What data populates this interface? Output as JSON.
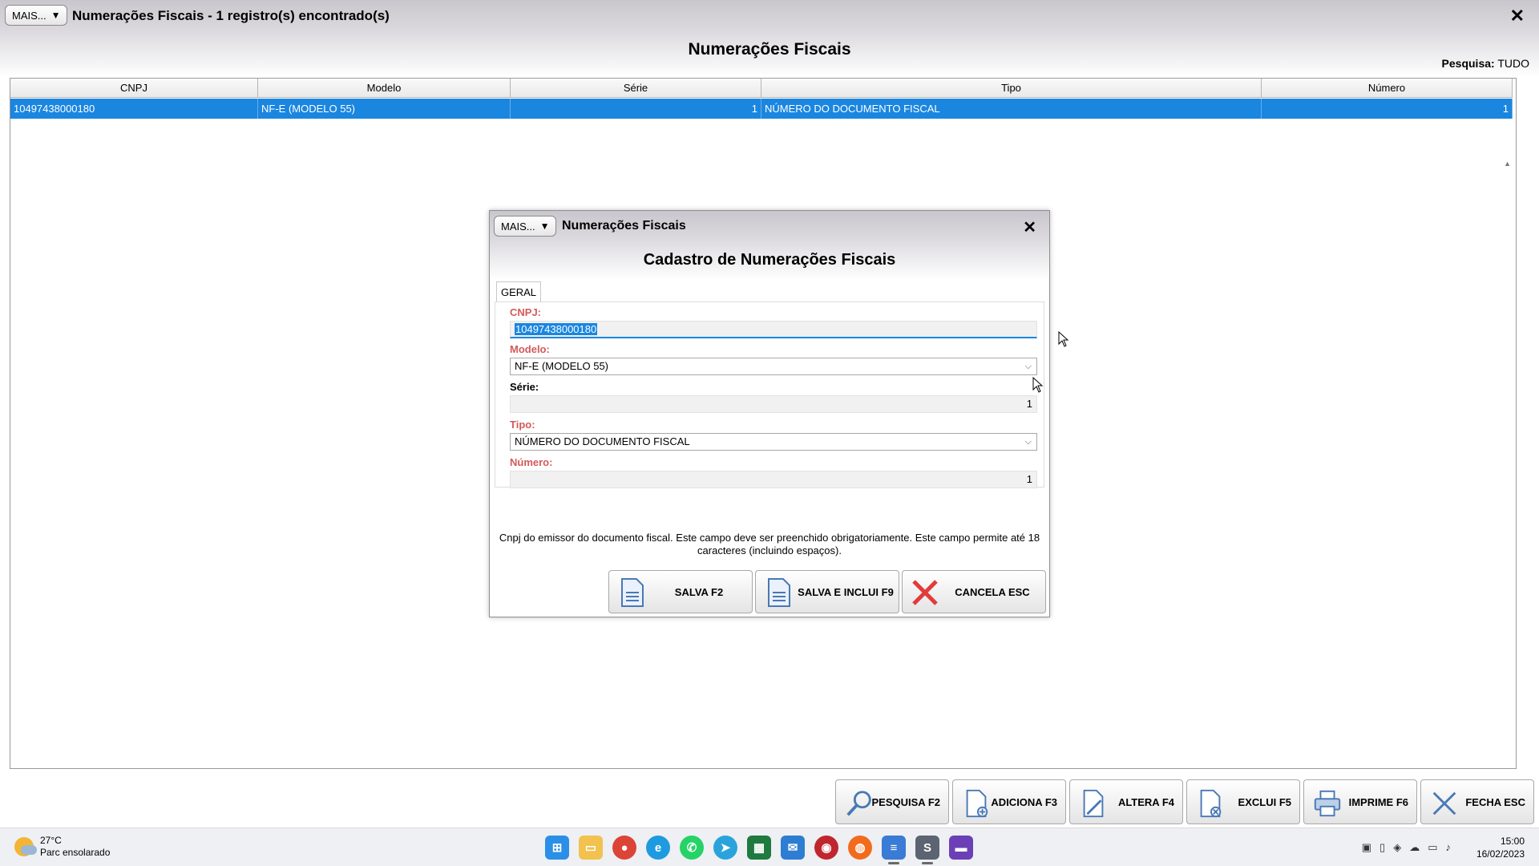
{
  "window": {
    "mais_label": "MAIS...",
    "title": "Numerações Fiscais - 1 registro(s) encontrado(s)",
    "close": "✕",
    "heading": "Numerações Fiscais",
    "search_label": "Pesquisa:",
    "search_value": "TUDO"
  },
  "grid": {
    "columns": [
      "CNPJ",
      "Modelo",
      "Série",
      "Tipo",
      "Número"
    ],
    "rows": [
      {
        "cnpj": "10497438000180",
        "modelo": "NF-E (MODELO 55)",
        "serie": "1",
        "tipo": "NÚMERO DO DOCUMENTO FISCAL",
        "numero": "1"
      }
    ],
    "selected_color": "#1a86e0"
  },
  "toolbar": {
    "pesquisa": "PESQUISA F2",
    "adiciona": "ADICIONA F3",
    "altera": "ALTERA F4",
    "exclui": "EXCLUI F5",
    "imprime": "IMPRIME F6",
    "fecha": "FECHA ESC"
  },
  "modal": {
    "mais_label": "MAIS...",
    "title": "Numerações Fiscais",
    "close": "✕",
    "heading": "Cadastro de Numerações Fiscais",
    "tab": "GERAL",
    "fields": {
      "cnpj_label": "CNPJ:",
      "cnpj_value": "10497438000180",
      "modelo_label": "Modelo:",
      "modelo_value": "NF-E (MODELO 55)",
      "serie_label": "Série:",
      "serie_value": "1",
      "tipo_label": "Tipo:",
      "tipo_value": "NÚMERO DO DOCUMENTO FISCAL",
      "numero_label": "Número:",
      "numero_value": "1"
    },
    "help_text": "Cnpj do emissor do documento fiscal. Este campo deve ser preenchido obrigatoriamente. Este campo permite até 18 caracteres (incluindo espaços).",
    "buttons": {
      "salva": "SALVA F2",
      "salva_inclui": "SALVA E INCLUI F9",
      "cancela": "CANCELA ESC"
    },
    "required_color": "#d45a5a"
  },
  "taskbar": {
    "temperature": "27°C",
    "weather": "Parc ensolarado",
    "time": "15:00",
    "date": "16/02/2023",
    "apps": [
      "windows-start-icon",
      "file-explorer-icon",
      "chrome-icon",
      "edge-icon",
      "whatsapp-icon",
      "telegram-icon",
      "spreadsheet-icon",
      "mail-icon",
      "app-red-icon",
      "firefox-icon",
      "notepad-icon",
      "erp-app-icon",
      "media-app-icon"
    ]
  }
}
